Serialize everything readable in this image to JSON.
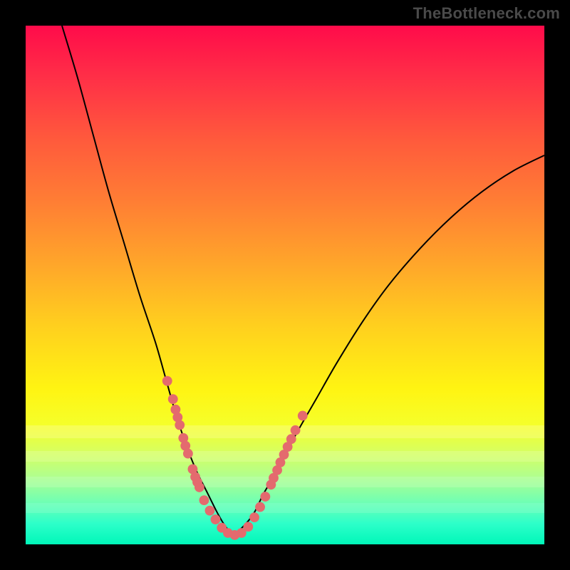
{
  "watermark": "TheBottleneck.com",
  "colors": {
    "frame": "#000000",
    "curve_stroke": "#000000",
    "marker_fill": "#e46a6e",
    "gradient_stops": [
      "#ff0b4a",
      "#ff2f47",
      "#ff5a3c",
      "#ff7e34",
      "#ffa62a",
      "#ffd01e",
      "#fff412",
      "#f5ff2a",
      "#d8ff5e",
      "#b0ff8e",
      "#6effb4",
      "#2dffc9",
      "#00f7b9"
    ]
  },
  "chart_data": {
    "type": "line",
    "title": "",
    "xlabel": "",
    "ylabel": "",
    "xlim": [
      0,
      100
    ],
    "ylim": [
      0,
      100
    ],
    "grid": false,
    "legend": false,
    "series": [
      {
        "name": "bottleneck-curve-left",
        "x": [
          7,
          10,
          13,
          16,
          19,
          22,
          25,
          27,
          29,
          31,
          33,
          35,
          37,
          38.5,
          40
        ],
        "values": [
          100,
          90,
          79,
          68,
          58,
          48,
          39,
          32,
          25,
          19,
          14,
          10,
          6,
          3.5,
          2
        ]
      },
      {
        "name": "bottleneck-curve-right",
        "x": [
          40,
          42,
          44,
          46,
          49,
          52,
          56,
          60,
          65,
          70,
          76,
          82,
          88,
          94,
          100
        ],
        "values": [
          2,
          3.5,
          6,
          10,
          15,
          21,
          28,
          35,
          43,
          50,
          57,
          63,
          68,
          72,
          75
        ]
      }
    ],
    "markers": {
      "name": "sample-points",
      "note": "approximate coral dots overlaid on the curve, read off the plot (y as percentage of plot height from bottom)",
      "points": [
        {
          "x": 27.3,
          "y": 31.5
        },
        {
          "x": 28.4,
          "y": 28.0
        },
        {
          "x": 28.9,
          "y": 26.0
        },
        {
          "x": 29.3,
          "y": 24.5
        },
        {
          "x": 29.7,
          "y": 23.0
        },
        {
          "x": 30.4,
          "y": 20.5
        },
        {
          "x": 30.8,
          "y": 19.0
        },
        {
          "x": 31.3,
          "y": 17.5
        },
        {
          "x": 32.2,
          "y": 14.5
        },
        {
          "x": 32.7,
          "y": 13.0
        },
        {
          "x": 33.1,
          "y": 12.0
        },
        {
          "x": 33.5,
          "y": 11.0
        },
        {
          "x": 34.4,
          "y": 8.5
        },
        {
          "x": 35.5,
          "y": 6.5
        },
        {
          "x": 36.6,
          "y": 4.8
        },
        {
          "x": 37.8,
          "y": 3.2
        },
        {
          "x": 39.0,
          "y": 2.2
        },
        {
          "x": 40.3,
          "y": 1.8
        },
        {
          "x": 41.6,
          "y": 2.2
        },
        {
          "x": 42.9,
          "y": 3.4
        },
        {
          "x": 44.1,
          "y": 5.2
        },
        {
          "x": 45.2,
          "y": 7.2
        },
        {
          "x": 46.2,
          "y": 9.2
        },
        {
          "x": 47.3,
          "y": 11.5
        },
        {
          "x": 47.8,
          "y": 12.8
        },
        {
          "x": 48.5,
          "y": 14.3
        },
        {
          "x": 49.1,
          "y": 15.8
        },
        {
          "x": 49.8,
          "y": 17.3
        },
        {
          "x": 50.5,
          "y": 18.8
        },
        {
          "x": 51.2,
          "y": 20.3
        },
        {
          "x": 52.0,
          "y": 22.0
        },
        {
          "x": 53.4,
          "y": 24.8
        }
      ]
    }
  }
}
